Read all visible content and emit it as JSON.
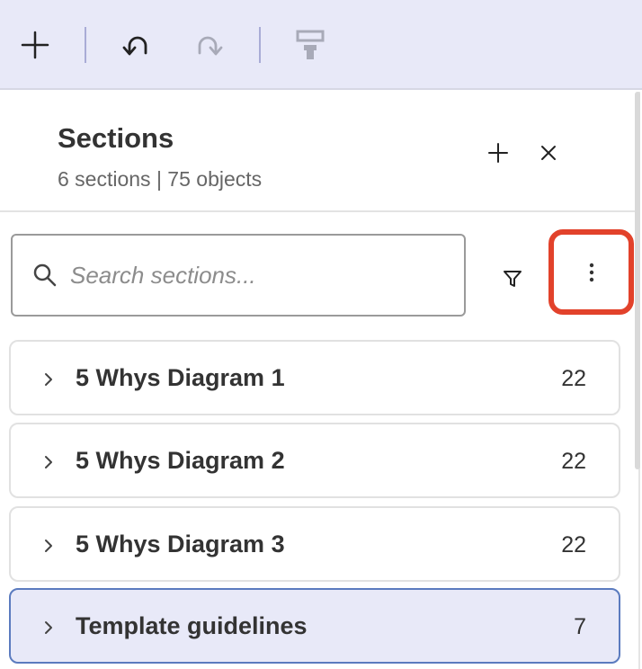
{
  "toolbar": {
    "icons": {
      "add": "plus-icon",
      "undo": "undo-icon",
      "redo": "redo-icon",
      "format_painter": "paint-roller-icon"
    }
  },
  "panel": {
    "title": "Sections",
    "subtitle": "6 sections | 75 objects",
    "search": {
      "placeholder": "Search sections...",
      "value": ""
    },
    "sections": [
      {
        "label": "5 Whys Diagram 1",
        "count": "22"
      },
      {
        "label": "5 Whys Diagram 2",
        "count": "22"
      },
      {
        "label": "5 Whys Diagram 3",
        "count": "22"
      },
      {
        "label": "Template guidelines",
        "count": "7"
      }
    ]
  },
  "colors": {
    "toolbar_bg": "#e8e9f8",
    "highlight": "#e2422b",
    "active_row_bg": "#e8e9f8",
    "active_row_border": "#5b7bbf"
  }
}
